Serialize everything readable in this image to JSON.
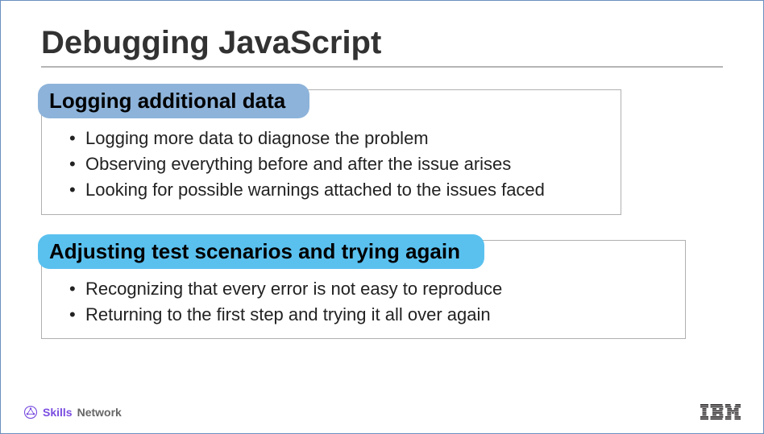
{
  "title": "Debugging JavaScript",
  "sections": [
    {
      "header": "Logging additional data",
      "bullets": [
        "Logging more data to diagnose the problem",
        "Observing everything before and after the issue arises",
        "Looking for possible warnings attached to the issues faced"
      ]
    },
    {
      "header": "Adjusting test scenarios and trying again",
      "bullets": [
        "Recognizing that every error is not easy to reproduce",
        "Returning to the first step and trying it all over again"
      ]
    }
  ],
  "footer": {
    "skills": "Skills",
    "network": "Network",
    "right_logo": "IBM"
  }
}
